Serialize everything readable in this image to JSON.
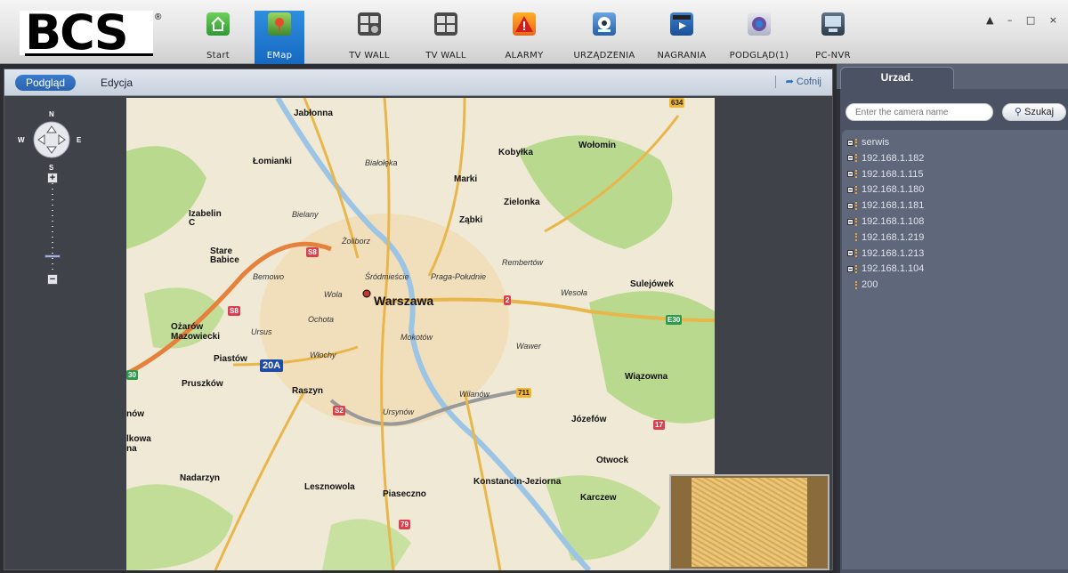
{
  "toolbar": {
    "logo_text": "BCS",
    "items": [
      {
        "label": "Start",
        "icon": "home-icon"
      },
      {
        "label": "EMap",
        "icon": "map-icon"
      },
      {
        "label": "TV WALL",
        "icon": "tv-wall-icon"
      },
      {
        "label": "TV WALL",
        "icon": "tv-wall-icon"
      },
      {
        "label": "ALARMY",
        "icon": "alarm-icon"
      },
      {
        "label": "URZĄDZENIA",
        "icon": "device-icon"
      },
      {
        "label": "NAGRANIA",
        "icon": "record-icon"
      },
      {
        "label": "PODGLĄD(1)",
        "icon": "preview-icon"
      },
      {
        "label": "PC-NVR",
        "icon": "pc-nvr-icon"
      }
    ],
    "active": "EMap",
    "window_controls": "▲ – □ ×"
  },
  "map_panel": {
    "tabs": [
      "Podgląd",
      "Edycja"
    ],
    "active_tab": "Podgląd",
    "undo_label": "Cofnij",
    "compass": {
      "n": "N",
      "s": "S",
      "e": "E",
      "w": "W"
    },
    "zoom_in": "+",
    "zoom_out": "−"
  },
  "map_labels": {
    "jablonna": "Jabłonna",
    "lomianki": "Łomianki",
    "bialoleka": "Białołęka",
    "kobylka": "Kobyłka",
    "wolomin": "Wołomin",
    "marki": "Marki",
    "zielonka": "Zielonka",
    "izabelin": "Izabelin C",
    "bielany": "Bielany",
    "zabki": "Ząbki",
    "zoliborz": "Żoliborz",
    "stare_babice": "Stare Babice",
    "rembertow": "Rembertów",
    "bemowo": "Bemowo",
    "srodmiescie": "Śródmieście",
    "praga": "Praga-Południe",
    "sulejowek": "Sulejówek",
    "wola": "Wola",
    "warszawa": "Warszawa",
    "wesola": "Wesoła",
    "ochota": "Ochota",
    "ozarow": "Ożarów Mazowiecki",
    "ursus": "Ursus",
    "mokotow": "Mokotów",
    "wawer": "Wawer",
    "piastow": "Piastów",
    "wlochy": "Włochy",
    "pruszkow": "Pruszków",
    "raszyn": "Raszyn",
    "wilanow": "Wilanów",
    "wiazowna": "Wiązowna",
    "ursynow": "Ursynów",
    "jozefow": "Józefów",
    "otwock": "Otwock",
    "nadarzyn": "Nadarzyn",
    "konstancin": "Konstancin-Jeziorna",
    "lesznowola": "Lesznowola",
    "piaseczno": "Piaseczno",
    "karczew": "Karczew",
    "edge_now": "nów",
    "edge_kowa": "lkowa na",
    "shield_s8a": "S8",
    "shield_s8b": "S8",
    "shield_2": "2",
    "shield_e30": "E30",
    "shield_20a": "20A",
    "shield_711": "711",
    "shield_s2": "S2",
    "shield_17": "17",
    "shield_79": "79",
    "shield_634": "634",
    "shield_30": "30"
  },
  "device_panel": {
    "tab_title": "Urzad.",
    "search_placeholder": "Enter the camera name",
    "search_button": "Szukaj",
    "tree": [
      {
        "label": "serwis",
        "expandable": true
      },
      {
        "label": "192.168.1.182",
        "expandable": true
      },
      {
        "label": "192.168.1.115",
        "expandable": true
      },
      {
        "label": "192.168.1.180",
        "expandable": true
      },
      {
        "label": "192.168.1.181",
        "expandable": true
      },
      {
        "label": "192.168.1.108",
        "expandable": true
      },
      {
        "label": "192.168.1.219",
        "expandable": false
      },
      {
        "label": "192.168.1.213",
        "expandable": true
      },
      {
        "label": "192.168.1.104",
        "expandable": true
      },
      {
        "label": "200",
        "expandable": false
      }
    ]
  },
  "colors": {
    "toolbar_active": "#1f7bd2",
    "panel_bg": "#5f677b",
    "map_bg": "#efe9d6",
    "forest": "#b9d98f",
    "motorway": "#e5813a",
    "river": "#9cc4e4"
  }
}
